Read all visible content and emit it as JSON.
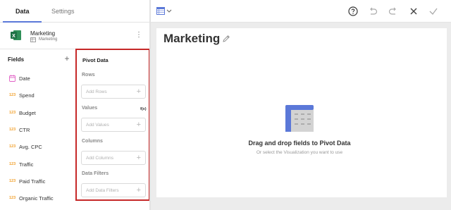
{
  "tabs": [
    {
      "label": "Data",
      "active": true
    },
    {
      "label": "Settings",
      "active": false
    }
  ],
  "datasource": {
    "name": "Marketing",
    "sheet": "Marketing",
    "icon": "excel-icon",
    "menu_icon": "kebab-icon",
    "menu_glyph": "⋮"
  },
  "fields_panel": {
    "title": "Fields",
    "add_glyph": "+",
    "items": [
      {
        "type": "date",
        "type_label": "",
        "label": "Date"
      },
      {
        "type": "number",
        "type_label": "123",
        "label": "Spend"
      },
      {
        "type": "number",
        "type_label": "123",
        "label": "Budget"
      },
      {
        "type": "number",
        "type_label": "123",
        "label": "CTR"
      },
      {
        "type": "number",
        "type_label": "123",
        "label": "Avg. CPC"
      },
      {
        "type": "number",
        "type_label": "123",
        "label": "Traffic"
      },
      {
        "type": "number",
        "type_label": "123",
        "label": "Paid Traffic"
      },
      {
        "type": "number",
        "type_label": "123",
        "label": "Organic Traffic"
      }
    ]
  },
  "pivot": {
    "title": "Pivot Data",
    "plus_glyph": "+",
    "values_extra": "f(x)",
    "sections": [
      {
        "label": "Rows",
        "placeholder": "Add Rows"
      },
      {
        "label": "Values",
        "placeholder": "Add Values"
      },
      {
        "label": "Columns",
        "placeholder": "Add Columns"
      },
      {
        "label": "Data Filters",
        "placeholder": "Add Data Filters"
      }
    ]
  },
  "toolbar": {
    "viz_picker_icon": "pivot-grid-icon",
    "icons": [
      "help-icon",
      "undo-icon",
      "redo-icon",
      "close-icon",
      "check-icon"
    ]
  },
  "visualization": {
    "title": "Marketing",
    "empty_title": "Drag and drop fields to Pivot Data",
    "empty_subtitle": "Or select the Visualization you want to use"
  },
  "colors": {
    "accent": "#5b78d8",
    "highlight_border": "#c62828",
    "number_type": "#f2a12d",
    "date_type": "#e05fc5",
    "excel_green": "#1e7145"
  }
}
